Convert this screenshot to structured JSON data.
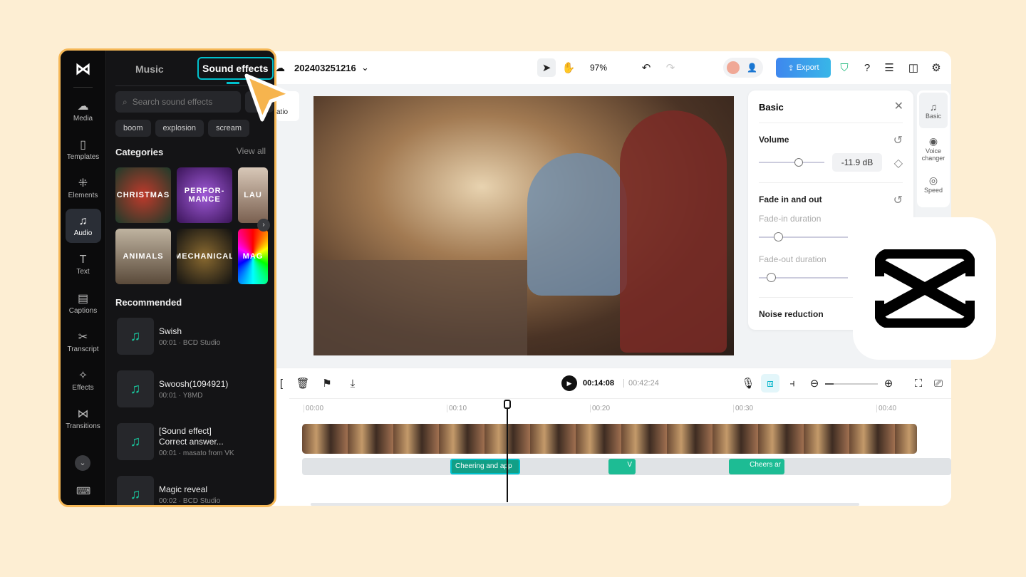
{
  "sidebar": {
    "nav": [
      {
        "label": "Media",
        "icon": "cloud-icon"
      },
      {
        "label": "Templates",
        "icon": "templates-icon"
      },
      {
        "label": "Elements",
        "icon": "elements-icon"
      },
      {
        "label": "Audio",
        "icon": "music-icon",
        "active": true
      },
      {
        "label": "Text",
        "icon": "text-icon"
      },
      {
        "label": "Captions",
        "icon": "captions-icon"
      },
      {
        "label": "Transcript",
        "icon": "transcript-icon"
      },
      {
        "label": "Effects",
        "icon": "effects-icon"
      },
      {
        "label": "Transitions",
        "icon": "transitions-icon"
      }
    ],
    "tabs": {
      "music": "Music",
      "sound_effects": "Sound effects"
    },
    "search_placeholder": "Search sound effects",
    "chips": [
      "boom",
      "explosion",
      "scream"
    ],
    "categories_title": "Categories",
    "view_all": "View all",
    "categories": [
      "CHRISTMAS",
      "PERFOR-\nMANCE",
      "LAU",
      "ANIMALS",
      "MECHANICAL",
      "MAG"
    ],
    "recommended_title": "Recommended",
    "recommended": [
      {
        "title": "Swish",
        "meta": "00:01 · BCD Studio"
      },
      {
        "title": "Swoosh(1094921)",
        "meta": "00:01 · Y8MD"
      },
      {
        "title": "[Sound effect] Correct answer...",
        "meta": "00:01 · masato from VK"
      },
      {
        "title": "Magic reveal",
        "meta": "00:02 · BCD Studio"
      }
    ]
  },
  "topbar": {
    "project": "202403251216",
    "zoom": "97%",
    "export": "Export"
  },
  "canvas": {
    "ratio_label": "atio"
  },
  "basic_panel": {
    "title": "Basic",
    "volume": "Volume",
    "volume_value": "-11.9 dB",
    "volume_level": 0.6,
    "fade": "Fade in and out",
    "fade_in": "Fade-in duration",
    "fade_out": "Fade-out duration",
    "noise": "Noise reduction"
  },
  "right_tabs": [
    {
      "label": "Basic"
    },
    {
      "label": "Voice changer"
    },
    {
      "label": "Speed"
    }
  ],
  "timeline": {
    "current": "00:14:08",
    "total": "00:42:24",
    "ticks": [
      "00:00",
      "00:10",
      "00:20",
      "00:30",
      "00:40"
    ],
    "clips": [
      "Cheering and app",
      "V",
      "Cheers ar"
    ]
  },
  "colors": {
    "accent": "#00c1cd",
    "orange": "#f6b857",
    "export": "#3a8ef0",
    "audio_clip": "#1dbc94"
  }
}
